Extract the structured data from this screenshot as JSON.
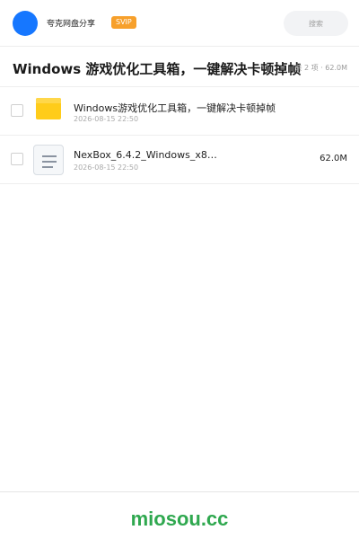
{
  "header": {
    "username": "夸克网盘分享",
    "badge": "SVIP",
    "search_placeholder": "搜索"
  },
  "title": {
    "text": "Windows 游戏优化工具箱，一键解决卡顿掉帧",
    "summary": "共 2 项 · 62.0M"
  },
  "files": [
    {
      "name": "Windows游戏优化工具箱，一键解决卡顿掉帧",
      "date": "2026-08-15 22:50",
      "size": "",
      "icon": "folder-icon"
    },
    {
      "name": "NexBox_6.4.2_Windows_x86_…",
      "date": "2026-08-15 22:50",
      "size": "62.0M",
      "icon": "document-icon"
    }
  ],
  "footer": {
    "brand": "miosou.cc"
  },
  "colors": {
    "avatar": "#1677ff",
    "svip": "#f7a02b",
    "folder": "#ffcc1a",
    "brand": "#2fa84f"
  }
}
